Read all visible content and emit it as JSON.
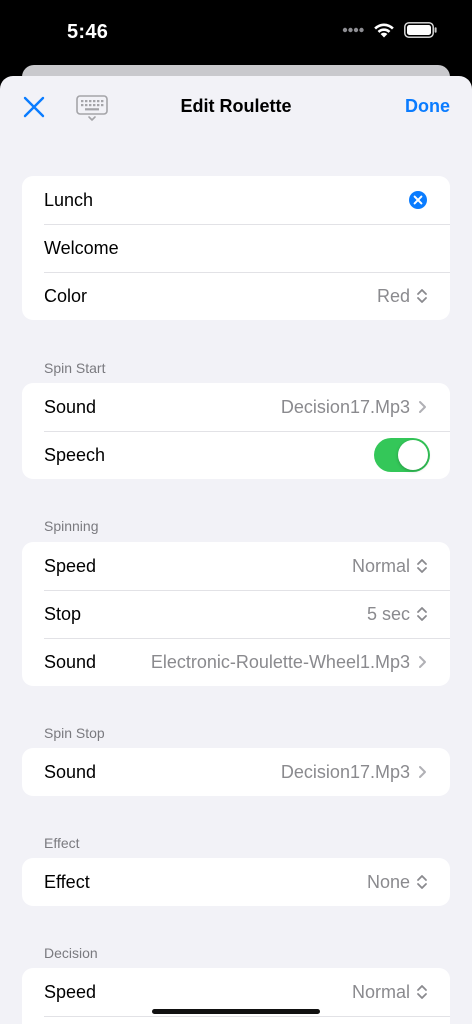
{
  "status": {
    "time": "5:46"
  },
  "nav": {
    "title": "Edit Roulette",
    "done_label": "Done"
  },
  "main_group": {
    "title_value": "Lunch",
    "subtitle_value": "Welcome",
    "color_label": "Color",
    "color_value": "Red"
  },
  "spin_start": {
    "header": "Spin Start",
    "sound_label": "Sound",
    "sound_value": "Decision17.Mp3",
    "speech_label": "Speech",
    "speech_on": true
  },
  "spinning": {
    "header": "Spinning",
    "speed_label": "Speed",
    "speed_value": "Normal",
    "stop_label": "Stop",
    "stop_value": "5 sec",
    "sound_label": "Sound",
    "sound_value": "Electronic-Roulette-Wheel1.Mp3"
  },
  "spin_stop": {
    "header": "Spin Stop",
    "sound_label": "Sound",
    "sound_value": "Decision17.Mp3"
  },
  "effect": {
    "header": "Effect",
    "effect_label": "Effect",
    "effect_value": "None"
  },
  "decision": {
    "header": "Decision",
    "speed_label": "Speed",
    "speed_value": "Normal"
  },
  "colors": {
    "accent": "#0a7cff",
    "toggle_on": "#34c759",
    "background": "#f2f2f7",
    "secondary_text": "#8a8a8e"
  }
}
